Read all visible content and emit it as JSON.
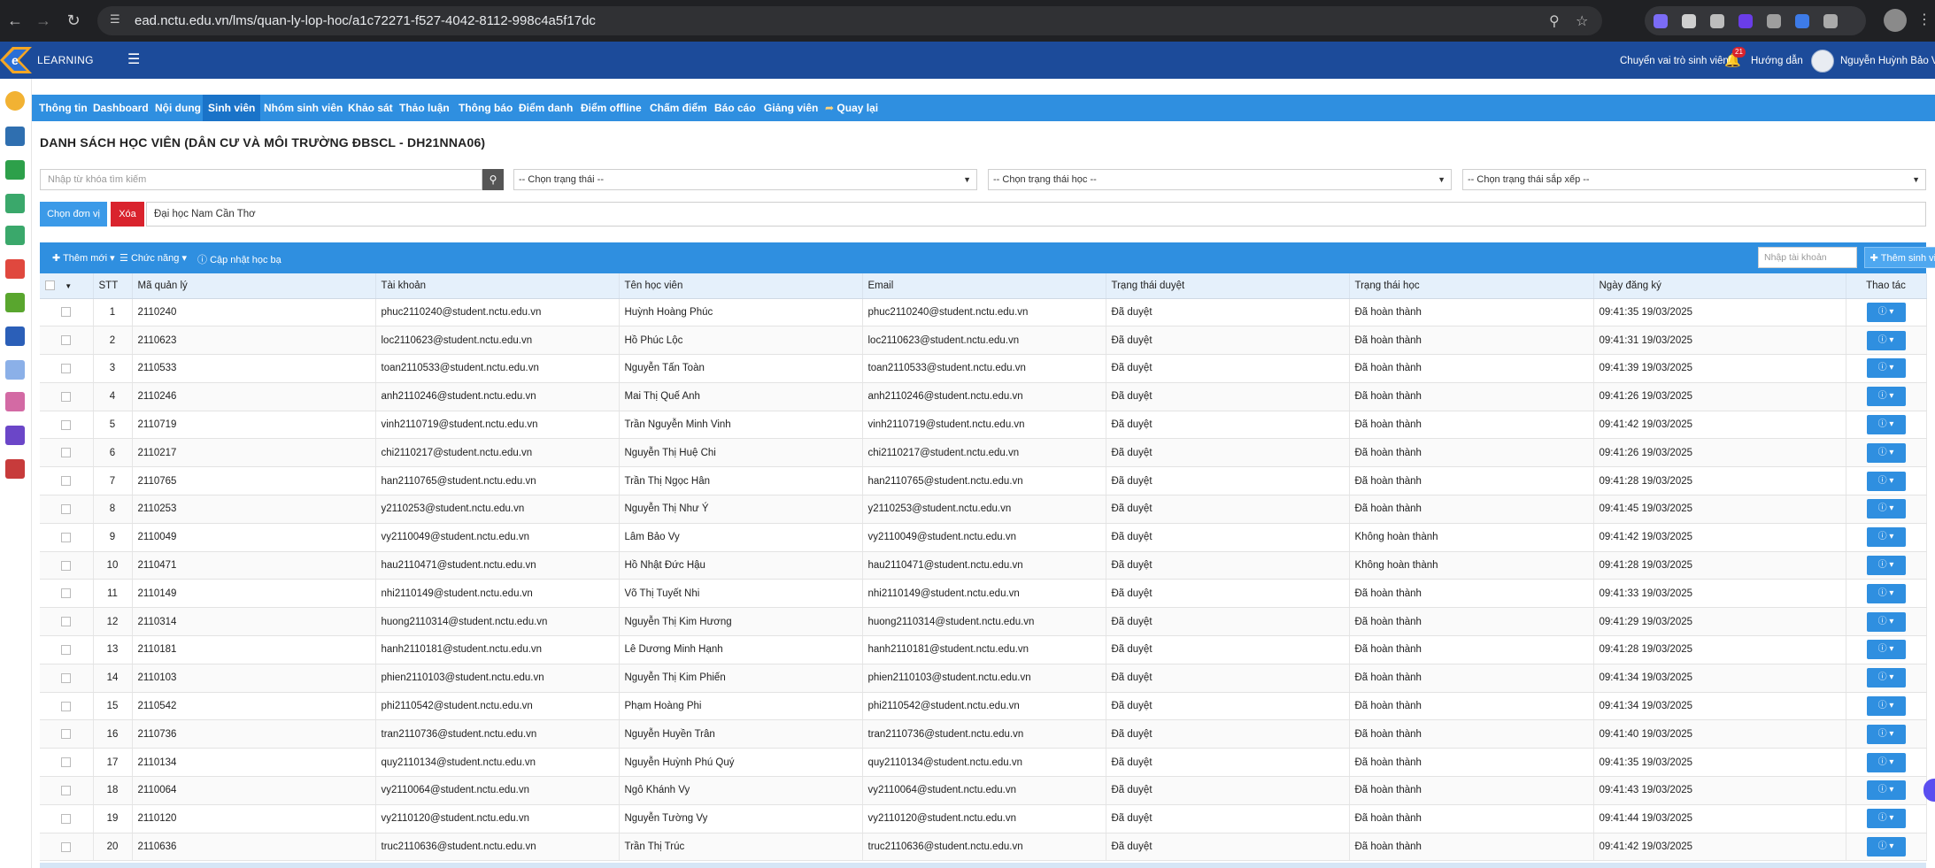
{
  "browser": {
    "url": "ead.nctu.edu.vn/lms/quan-ly-lop-hoc/a1c72271-f527-4042-8112-998c4a5f17dc"
  },
  "header": {
    "logo_text": "LEARNING",
    "switch_role": "Chuyển vai trò sinh viên",
    "notification_count": "21",
    "guide": "Hướng dẫn",
    "user_name": "Nguyễn Huỳnh Bảo Vinh"
  },
  "tabs": [
    {
      "label": "Thông tin"
    },
    {
      "label": "Dashboard"
    },
    {
      "label": "Nội dung"
    },
    {
      "label": "Sinh viên"
    },
    {
      "label": "Nhóm sinh viên"
    },
    {
      "label": "Khảo sát"
    },
    {
      "label": "Thảo luận"
    },
    {
      "label": "Thông báo"
    },
    {
      "label": "Điểm danh"
    },
    {
      "label": "Điểm offline"
    },
    {
      "label": "Chấm điểm"
    },
    {
      "label": "Báo cáo"
    },
    {
      "label": "Giảng viên"
    },
    {
      "label": "Quay lại"
    }
  ],
  "page_title": "DANH SÁCH HỌC VIÊN (DÂN CƯ VÀ MÔI TRƯỜNG ĐBSCL - DH21NNA06)",
  "filters": {
    "search_placeholder": "Nhập từ khóa tìm kiếm",
    "status": "-- Chọn trạng thái --",
    "study_status": "-- Chọn trạng thái học --",
    "sort_status": "-- Chọn trạng thái sắp xếp --"
  },
  "unit": {
    "choose_label": "Chọn đơn vị",
    "clear_label": "Xóa",
    "value": "Đại học Nam Cần Thơ"
  },
  "toolbar": {
    "add_new": "Thêm mới",
    "functions": "Chức năng",
    "update_grade": "Cập nhật học bạ",
    "account_placeholder": "Nhập tài khoản",
    "add_student": "Thêm sinh viên"
  },
  "table": {
    "headers": {
      "stt": "STT",
      "code": "Mã quản lý",
      "account": "Tài khoản",
      "name": "Tên học viên",
      "email": "Email",
      "approval": "Trạng thái duyệt",
      "study": "Trạng thái học",
      "date": "Ngày đăng ký",
      "action": "Thao tác"
    },
    "rows": [
      {
        "stt": "1",
        "code": "2110240",
        "account": "phuc2110240@student.nctu.edu.vn",
        "name": "Huỳnh Hoàng Phúc",
        "email": "phuc2110240@student.nctu.edu.vn",
        "approval": "Đã duyệt",
        "study": "Đã hoàn thành",
        "date": "09:41:35 19/03/2025"
      },
      {
        "stt": "2",
        "code": "2110623",
        "account": "loc2110623@student.nctu.edu.vn",
        "name": "Hồ Phúc Lộc",
        "email": "loc2110623@student.nctu.edu.vn",
        "approval": "Đã duyệt",
        "study": "Đã hoàn thành",
        "date": "09:41:31 19/03/2025"
      },
      {
        "stt": "3",
        "code": "2110533",
        "account": "toan2110533@student.nctu.edu.vn",
        "name": "Nguyễn Tấn Toàn",
        "email": "toan2110533@student.nctu.edu.vn",
        "approval": "Đã duyệt",
        "study": "Đã hoàn thành",
        "date": "09:41:39 19/03/2025"
      },
      {
        "stt": "4",
        "code": "2110246",
        "account": "anh2110246@student.nctu.edu.vn",
        "name": "Mai Thị Quế Anh",
        "email": "anh2110246@student.nctu.edu.vn",
        "approval": "Đã duyệt",
        "study": "Đã hoàn thành",
        "date": "09:41:26 19/03/2025"
      },
      {
        "stt": "5",
        "code": "2110719",
        "account": "vinh2110719@student.nctu.edu.vn",
        "name": "Trần Nguyễn Minh Vinh",
        "email": "vinh2110719@student.nctu.edu.vn",
        "approval": "Đã duyệt",
        "study": "Đã hoàn thành",
        "date": "09:41:42 19/03/2025"
      },
      {
        "stt": "6",
        "code": "2110217",
        "account": "chi2110217@student.nctu.edu.vn",
        "name": "Nguyễn Thị Huệ Chi",
        "email": "chi2110217@student.nctu.edu.vn",
        "approval": "Đã duyệt",
        "study": "Đã hoàn thành",
        "date": "09:41:26 19/03/2025"
      },
      {
        "stt": "7",
        "code": "2110765",
        "account": "han2110765@student.nctu.edu.vn",
        "name": "Trần Thị Ngọc Hân",
        "email": "han2110765@student.nctu.edu.vn",
        "approval": "Đã duyệt",
        "study": "Đã hoàn thành",
        "date": "09:41:28 19/03/2025"
      },
      {
        "stt": "8",
        "code": "2110253",
        "account": "y2110253@student.nctu.edu.vn",
        "name": "Nguyễn Thị Như Ý",
        "email": "y2110253@student.nctu.edu.vn",
        "approval": "Đã duyệt",
        "study": "Đã hoàn thành",
        "date": "09:41:45 19/03/2025"
      },
      {
        "stt": "9",
        "code": "2110049",
        "account": "vy2110049@student.nctu.edu.vn",
        "name": "Lâm Bảo Vy",
        "email": "vy2110049@student.nctu.edu.vn",
        "approval": "Đã duyệt",
        "study": "Không hoàn thành",
        "date": "09:41:42 19/03/2025"
      },
      {
        "stt": "10",
        "code": "2110471",
        "account": "hau2110471@student.nctu.edu.vn",
        "name": "Hồ Nhật Đức Hậu",
        "email": "hau2110471@student.nctu.edu.vn",
        "approval": "Đã duyệt",
        "study": "Không hoàn thành",
        "date": "09:41:28 19/03/2025"
      },
      {
        "stt": "11",
        "code": "2110149",
        "account": "nhi2110149@student.nctu.edu.vn",
        "name": "Võ Thị Tuyết Nhi",
        "email": "nhi2110149@student.nctu.edu.vn",
        "approval": "Đã duyệt",
        "study": "Đã hoàn thành",
        "date": "09:41:33 19/03/2025"
      },
      {
        "stt": "12",
        "code": "2110314",
        "account": "huong2110314@student.nctu.edu.vn",
        "name": "Nguyễn Thị Kim Hương",
        "email": "huong2110314@student.nctu.edu.vn",
        "approval": "Đã duyệt",
        "study": "Đã hoàn thành",
        "date": "09:41:29 19/03/2025"
      },
      {
        "stt": "13",
        "code": "2110181",
        "account": "hanh2110181@student.nctu.edu.vn",
        "name": "Lê Dương Minh Hạnh",
        "email": "hanh2110181@student.nctu.edu.vn",
        "approval": "Đã duyệt",
        "study": "Đã hoàn thành",
        "date": "09:41:28 19/03/2025"
      },
      {
        "stt": "14",
        "code": "2110103",
        "account": "phien2110103@student.nctu.edu.vn",
        "name": "Nguyễn Thị Kim Phiến",
        "email": "phien2110103@student.nctu.edu.vn",
        "approval": "Đã duyệt",
        "study": "Đã hoàn thành",
        "date": "09:41:34 19/03/2025"
      },
      {
        "stt": "15",
        "code": "2110542",
        "account": "phi2110542@student.nctu.edu.vn",
        "name": "Phạm Hoàng Phi",
        "email": "phi2110542@student.nctu.edu.vn",
        "approval": "Đã duyệt",
        "study": "Đã hoàn thành",
        "date": "09:41:34 19/03/2025"
      },
      {
        "stt": "16",
        "code": "2110736",
        "account": "tran2110736@student.nctu.edu.vn",
        "name": "Nguyễn Huyền Trân",
        "email": "tran2110736@student.nctu.edu.vn",
        "approval": "Đã duyệt",
        "study": "Đã hoàn thành",
        "date": "09:41:40 19/03/2025"
      },
      {
        "stt": "17",
        "code": "2110134",
        "account": "quy2110134@student.nctu.edu.vn",
        "name": "Nguyễn Huỳnh Phú Quý",
        "email": "quy2110134@student.nctu.edu.vn",
        "approval": "Đã duyệt",
        "study": "Đã hoàn thành",
        "date": "09:41:35 19/03/2025"
      },
      {
        "stt": "18",
        "code": "2110064",
        "account": "vy2110064@student.nctu.edu.vn",
        "name": "Ngô Khánh Vy",
        "email": "vy2110064@student.nctu.edu.vn",
        "approval": "Đã duyệt",
        "study": "Đã hoàn thành",
        "date": "09:41:43 19/03/2025"
      },
      {
        "stt": "19",
        "code": "2110120",
        "account": "vy2110120@student.nctu.edu.vn",
        "name": "Nguyễn Tường Vy",
        "email": "vy2110120@student.nctu.edu.vn",
        "approval": "Đã duyệt",
        "study": "Đã hoàn thành",
        "date": "09:41:44 19/03/2025"
      },
      {
        "stt": "20",
        "code": "2110636",
        "account": "truc2110636@student.nctu.edu.vn",
        "name": "Trần Thị Trúc",
        "email": "truc2110636@student.nctu.edu.vn",
        "approval": "Đã duyệt",
        "study": "Đã hoàn thành",
        "date": "09:41:42 19/03/2025"
      }
    ]
  },
  "colors": {
    "header_bg": "#1c4b9a",
    "tab_bg": "#2f8fe0",
    "danger": "#d9232d"
  }
}
